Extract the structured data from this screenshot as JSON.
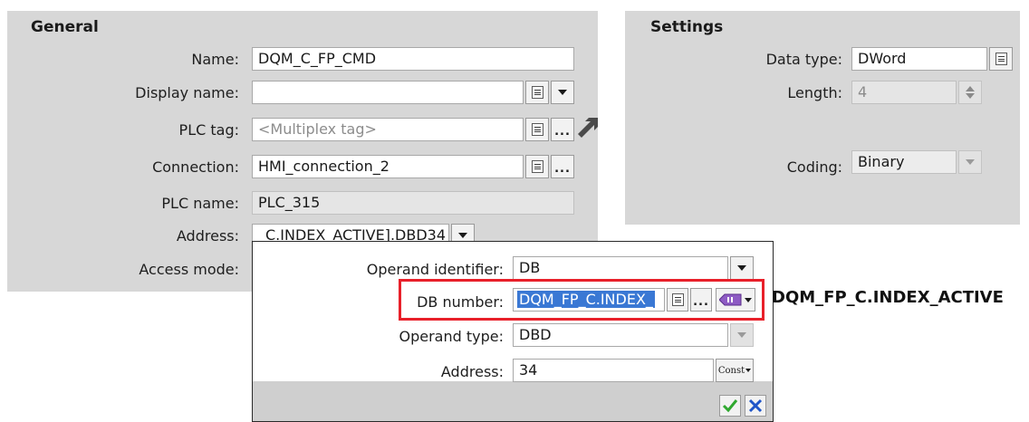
{
  "general": {
    "title": "General",
    "name": {
      "label": "Name:",
      "value": "DQM_C_FP_CMD"
    },
    "display_name": {
      "label": "Display name:",
      "value": ""
    },
    "plc_tag": {
      "label": "PLC tag:",
      "placeholder": "<Multiplex tag>"
    },
    "connection": {
      "label": "Connection:",
      "value": "HMI_connection_2"
    },
    "plc_name": {
      "label": "PLC name:",
      "value": "PLC_315"
    },
    "address": {
      "label": "Address:",
      "value": "_C.INDEX_ACTIVE].DBD34"
    },
    "access_mode": {
      "label": "Access mode:"
    }
  },
  "settings": {
    "title": "Settings",
    "data_type": {
      "label": "Data type:",
      "value": "DWord"
    },
    "length": {
      "label": "Length:",
      "value": "4"
    },
    "coding": {
      "label": "Coding:",
      "value": "Binary"
    }
  },
  "popup": {
    "operand_identifier": {
      "label": "Operand identifier:",
      "value": "DB"
    },
    "db_number": {
      "label": "DB number:",
      "value": "DQM_FP_C.INDEX_"
    },
    "operand_type": {
      "label": "Operand type:",
      "value": "DBD"
    },
    "address": {
      "label": "Address:",
      "value": "34"
    },
    "const_label": "Const"
  },
  "tooltip": "DQM_FP_C.INDEX_ACTIVE",
  "colors": {
    "panel_bg": "#d7d7d7",
    "highlight": "#e8202a",
    "selection": "#3a78d4",
    "confirm": "#2fa82f",
    "cancel": "#1f55c8"
  }
}
